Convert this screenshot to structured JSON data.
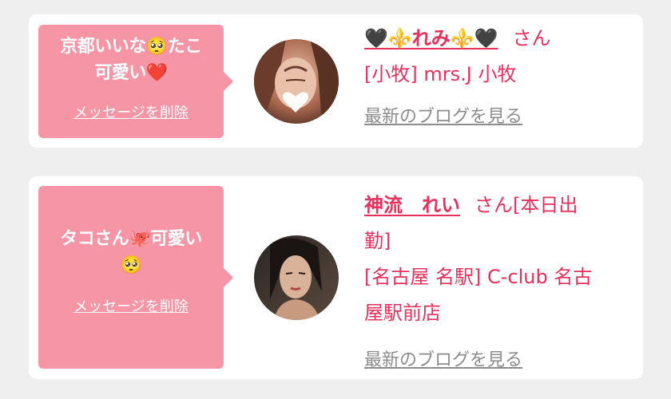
{
  "messages": [
    {
      "text_line1": "京都いいな🥺たこ",
      "text_line2": "可愛い❤️",
      "delete_label": "メッセージを削除",
      "name": "🖤⚜️れみ⚜️🖤",
      "honorific": "さん",
      "detail_line1": "[小牧] mrs.J 小牧",
      "blog_link": "最新のブログを見る"
    },
    {
      "text_line1": "タコさん🐙可愛い",
      "text_line2": "🥺",
      "delete_label": "メッセージを削除",
      "name": "神流　れい",
      "honorific": "さん[本日出",
      "honorific_line2": "勤]",
      "detail_line1": "[名古屋 名駅] C-club 名古",
      "detail_line2": "屋駅前店",
      "blog_link": "最新のブログを見る"
    }
  ],
  "colors": {
    "bubble": "#f595a6",
    "accent": "#e8305c",
    "muted": "#8c8c8c",
    "background": "#efefef"
  }
}
